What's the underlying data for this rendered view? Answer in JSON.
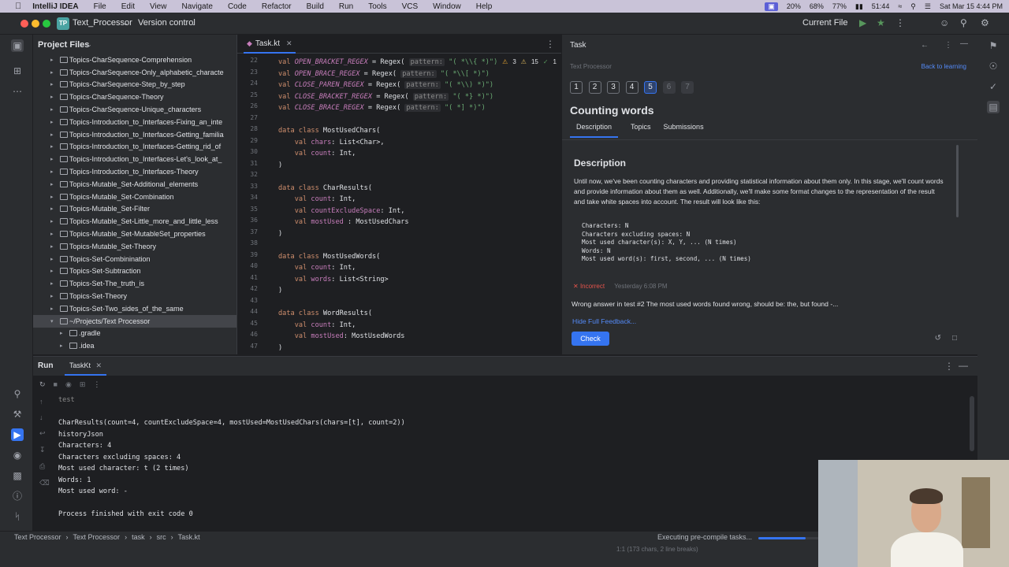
{
  "macbar": {
    "app_name": "IntelliJ IDEA",
    "menus": [
      "File",
      "Edit",
      "View",
      "Navigate",
      "Code",
      "Refactor",
      "Build",
      "Run",
      "Tools",
      "VCS",
      "Window",
      "Help"
    ],
    "status_items": [
      "20%",
      "68%",
      "77%",
      "51:44"
    ],
    "datetime": "Sat Mar 15  4:44 PM"
  },
  "titlebar": {
    "project_badge": "TP",
    "project_name": "Text_Processor",
    "version_control": "Version control",
    "run_config": "Current File"
  },
  "project_panel": {
    "title": "Project Files",
    "items": [
      {
        "label": "Topics-CharSequence-Comprehension",
        "selected": false
      },
      {
        "label": "Topics-CharSequence-Only_alphabetic_characte",
        "selected": false
      },
      {
        "label": "Topics-CharSequence-Step_by_step",
        "selected": false
      },
      {
        "label": "Topics-CharSequence-Theory",
        "selected": false
      },
      {
        "label": "Topics-CharSequence-Unique_characters",
        "selected": false
      },
      {
        "label": "Topics-Introduction_to_Interfaces-Fixing_an_inte",
        "selected": false
      },
      {
        "label": "Topics-Introduction_to_Interfaces-Getting_familia",
        "selected": false
      },
      {
        "label": "Topics-Introduction_to_Interfaces-Getting_rid_of",
        "selected": false
      },
      {
        "label": "Topics-Introduction_to_Interfaces-Let's_look_at_",
        "selected": false
      },
      {
        "label": "Topics-Introduction_to_Interfaces-Theory",
        "selected": false
      },
      {
        "label": "Topics-Mutable_Set-Additional_elements",
        "selected": false
      },
      {
        "label": "Topics-Mutable_Set-Combination",
        "selected": false
      },
      {
        "label": "Topics-Mutable_Set-Filter",
        "selected": false
      },
      {
        "label": "Topics-Mutable_Set-Little_more_and_little_less",
        "selected": false
      },
      {
        "label": "Topics-Mutable_Set-MutableSet_properties",
        "selected": false
      },
      {
        "label": "Topics-Mutable_Set-Theory",
        "selected": false
      },
      {
        "label": "Topics-Set-Combinination",
        "selected": false
      },
      {
        "label": "Topics-Set-Subtraction",
        "selected": false
      },
      {
        "label": "Topics-Set-The_truth_is",
        "selected": false
      },
      {
        "label": "Topics-Set-Theory",
        "selected": false
      },
      {
        "label": "Topics-Set-Two_sides_of_the_same",
        "selected": false
      },
      {
        "label": "~/Projects/Text Processor",
        "selected": true
      },
      {
        "label": ".gradle",
        "selected": false
      },
      {
        "label": ".idea",
        "selected": false
      }
    ]
  },
  "editor": {
    "tab_label": "Task.kt",
    "inspection_counts": [
      "3",
      "15",
      "1"
    ],
    "line_numbers": [
      "22",
      "23",
      "24",
      "25",
      "26",
      "27",
      "28",
      "29",
      "30",
      "31",
      "32",
      "33",
      "34",
      "35",
      "36",
      "37",
      "38",
      "39",
      "40",
      "41",
      "42",
      "43",
      "44",
      "45",
      "46",
      "47"
    ],
    "lines": [
      [
        {
          "t": "val ",
          "c": "kw"
        },
        {
          "t": "OPEN_BRACKET_REGEX",
          "c": "cn"
        },
        {
          "t": " = Regex( ",
          "c": "fn"
        },
        {
          "t": "pattern:",
          "c": "hint"
        },
        {
          "t": " \"( *\\\\{ *)\")",
          "c": "str"
        }
      ],
      [
        {
          "t": "val ",
          "c": "kw"
        },
        {
          "t": "OPEN_BRACE_REGEX",
          "c": "cn"
        },
        {
          "t": " = Regex( ",
          "c": "fn"
        },
        {
          "t": "pattern:",
          "c": "hint"
        },
        {
          "t": " \"( *\\\\[ *)\")",
          "c": "str"
        }
      ],
      [
        {
          "t": "val ",
          "c": "kw"
        },
        {
          "t": "CLOSE_PAREN_REGEX",
          "c": "cn"
        },
        {
          "t": " = Regex( ",
          "c": "fn"
        },
        {
          "t": "pattern:",
          "c": "hint"
        },
        {
          "t": " \"( *\\\\) *)\")",
          "c": "str"
        }
      ],
      [
        {
          "t": "val ",
          "c": "kw"
        },
        {
          "t": "CLOSE_BRACKET_REGEX",
          "c": "cn"
        },
        {
          "t": " = Regex( ",
          "c": "fn"
        },
        {
          "t": "pattern:",
          "c": "hint"
        },
        {
          "t": " \"( *} *)\")",
          "c": "str"
        }
      ],
      [
        {
          "t": "val ",
          "c": "kw"
        },
        {
          "t": "CLOSE_BRACE_REGEX",
          "c": "cn"
        },
        {
          "t": " = Regex( ",
          "c": "fn"
        },
        {
          "t": "pattern:",
          "c": "hint"
        },
        {
          "t": " \"( *] *)\")",
          "c": "str"
        }
      ],
      [],
      [
        {
          "t": "data class ",
          "c": "kw"
        },
        {
          "t": "MostUsedChars(",
          "c": "fn"
        }
      ],
      [
        {
          "t": "    val ",
          "c": "kw"
        },
        {
          "t": "chars",
          "c": "prop"
        },
        {
          "t": ": List<Char>,",
          "c": "fn"
        }
      ],
      [
        {
          "t": "    val ",
          "c": "kw"
        },
        {
          "t": "count",
          "c": "prop"
        },
        {
          "t": ": Int,",
          "c": "fn"
        }
      ],
      [
        {
          "t": ")",
          "c": "fn"
        }
      ],
      [],
      [
        {
          "t": "data class ",
          "c": "kw"
        },
        {
          "t": "CharResults(",
          "c": "fn"
        }
      ],
      [
        {
          "t": "    val ",
          "c": "kw"
        },
        {
          "t": "count",
          "c": "prop"
        },
        {
          "t": ": Int,",
          "c": "fn"
        }
      ],
      [
        {
          "t": "    val ",
          "c": "kw"
        },
        {
          "t": "countExcludeSpace",
          "c": "prop"
        },
        {
          "t": ": Int,",
          "c": "fn"
        }
      ],
      [
        {
          "t": "    val ",
          "c": "kw"
        },
        {
          "t": "mostUsed",
          "c": "prop"
        },
        {
          "t": " : MostUsedChars",
          "c": "fn"
        }
      ],
      [
        {
          "t": ")",
          "c": "fn"
        }
      ],
      [],
      [
        {
          "t": "data class ",
          "c": "kw"
        },
        {
          "t": "MostUsedWords(",
          "c": "fn"
        }
      ],
      [
        {
          "t": "    val ",
          "c": "kw"
        },
        {
          "t": "count",
          "c": "prop"
        },
        {
          "t": ": Int,",
          "c": "fn"
        }
      ],
      [
        {
          "t": "    val ",
          "c": "kw"
        },
        {
          "t": "words",
          "c": "prop"
        },
        {
          "t": ": List<String>",
          "c": "fn"
        }
      ],
      [
        {
          "t": ")",
          "c": "fn"
        }
      ],
      [],
      [
        {
          "t": "data class ",
          "c": "kw"
        },
        {
          "t": "WordResults(",
          "c": "fn"
        }
      ],
      [
        {
          "t": "    val ",
          "c": "kw"
        },
        {
          "t": "count",
          "c": "prop"
        },
        {
          "t": ": Int,",
          "c": "fn"
        }
      ],
      [
        {
          "t": "    val ",
          "c": "kw"
        },
        {
          "t": "mostUsed",
          "c": "prop"
        },
        {
          "t": ": MostUsedWords",
          "c": "fn"
        }
      ],
      [
        {
          "t": ")",
          "c": "fn"
        }
      ]
    ]
  },
  "task": {
    "header": "Task",
    "course": "Text Processor",
    "back_link": "Back to learning",
    "steps": [
      "1",
      "2",
      "3",
      "4",
      "5",
      "6",
      "7"
    ],
    "active_step": "5",
    "title": "Counting words",
    "tabs": [
      "Description",
      "Topics",
      "Submissions"
    ],
    "description_heading": "Description",
    "description_text": "Until now, we've been counting characters and providing statistical information about them only. In this stage, we'll count words and provide information about them as well. Additionally, we'll make some format changes to the representation of the result and take white spaces into account. The result will look like this:",
    "sample_output": [
      "Characters: N",
      "Characters excluding spaces: N",
      "Most used character(s): X, Y, ... (N times)",
      "Words: N",
      "Most used word(s): first, second, ... (N times)"
    ],
    "result_status": "Incorrect",
    "result_time": "Yesterday 6:08 PM",
    "feedback": "Wrong answer in test #2 The most used words found wrong, should be: the, but found -...",
    "hide_feedback": "Hide Full Feedback...",
    "check_button": "Check"
  },
  "run": {
    "label": "Run",
    "tab": "TaskKt",
    "output": [
      "test",
      "",
      "CharResults(count=4, countExcludeSpace=4, mostUsed=MostUsedChars(chars=[t], count=2))",
      "historyJson",
      "Characters: 4",
      "Characters excluding spaces: 4",
      "Most used character: t (2 times)",
      "Words: 1",
      "Most used word: -",
      "",
      "Process finished with exit code 0"
    ]
  },
  "status": {
    "breadcrumb": [
      "Text Processor",
      "Text Processor",
      "task",
      "src",
      "Task.kt"
    ],
    "progress_text": "Executing pre-compile tasks...",
    "progress_fraction": 0.75,
    "cursor_info": "1:1 (173 chars, 2 line breaks)"
  },
  "colors": {
    "accent": "#3574f0",
    "incorrect": "#e5534b",
    "background": "#1e1f22",
    "panel": "#2b2d30"
  }
}
